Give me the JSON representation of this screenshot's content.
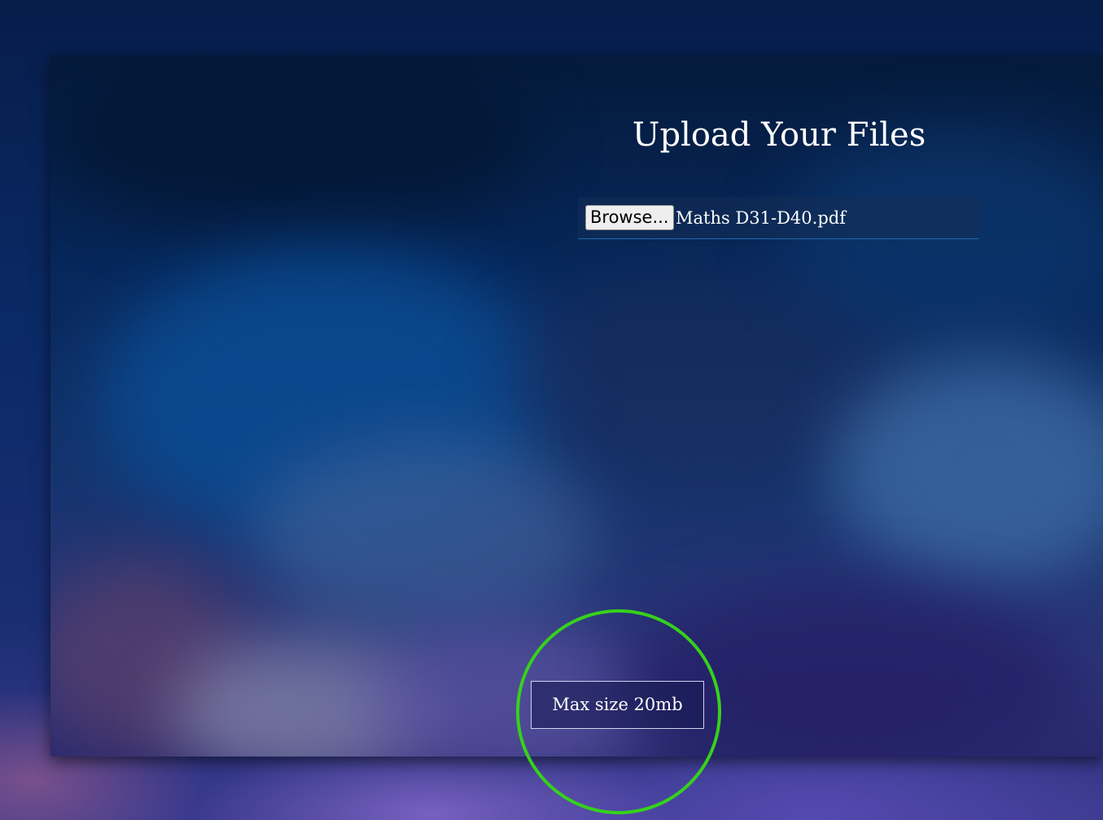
{
  "upload": {
    "title": "Upload Your Files",
    "browse_label": "Browse...",
    "selected_file": "Maths D31-D40.pdf",
    "max_size_label": "Max size 20mb"
  },
  "colors": {
    "highlight": "#36d11c",
    "underline": "#1e6aa8",
    "text": "#ffffff"
  }
}
